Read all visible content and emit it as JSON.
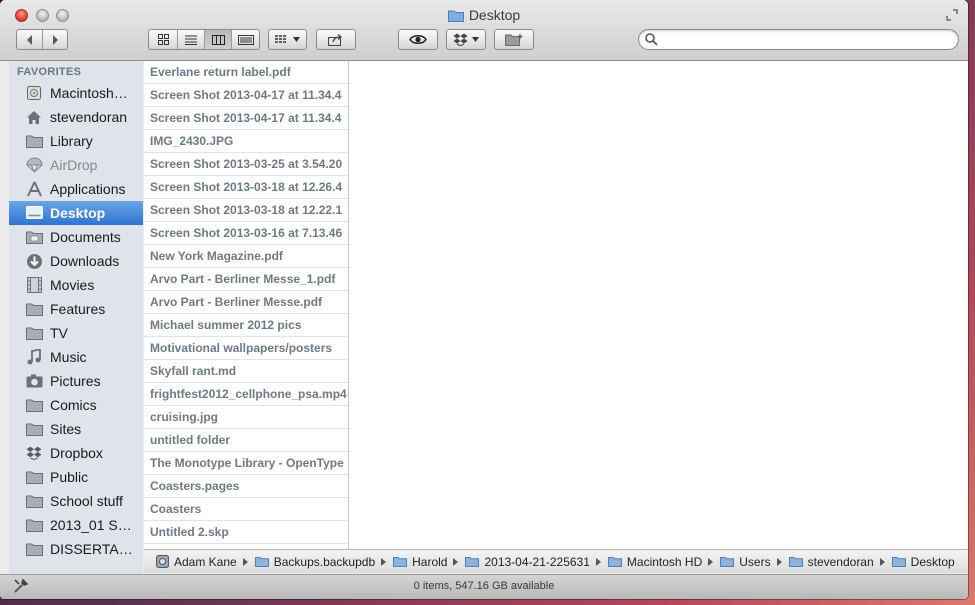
{
  "window": {
    "title": "Desktop"
  },
  "toolbar": {
    "back_icon": "chevron-left-icon",
    "forward_icon": "chevron-right-icon",
    "view_modes": [
      "icon-view",
      "list-view",
      "column-view",
      "cover-flow-view"
    ],
    "active_view": "column-view",
    "arrange_icon": "arrange-grid-icon",
    "share_icon": "share-icon",
    "quicklook_icon": "eye-icon",
    "dropbox_icon": "dropbox-icon",
    "new_folder_icon": "new-folder-icon"
  },
  "search": {
    "value": "",
    "placeholder": ""
  },
  "sidebar": {
    "heading": "FAVORITES",
    "items": [
      {
        "label": "Macintosh…",
        "icon": "hard-drive-icon"
      },
      {
        "label": "stevendoran",
        "icon": "home-icon"
      },
      {
        "label": "Library",
        "icon": "folder-icon"
      },
      {
        "label": "AirDrop",
        "icon": "airdrop-icon"
      },
      {
        "label": "Applications",
        "icon": "applications-icon"
      },
      {
        "label": "Desktop",
        "icon": "desktop-icon"
      },
      {
        "label": "Documents",
        "icon": "documents-icon"
      },
      {
        "label": "Downloads",
        "icon": "downloads-icon"
      },
      {
        "label": "Movies",
        "icon": "movies-icon"
      },
      {
        "label": "Features",
        "icon": "folder-icon"
      },
      {
        "label": "TV",
        "icon": "folder-icon"
      },
      {
        "label": "Music",
        "icon": "music-icon"
      },
      {
        "label": "Pictures",
        "icon": "pictures-icon"
      },
      {
        "label": "Comics",
        "icon": "folder-icon"
      },
      {
        "label": "Sites",
        "icon": "sites-icon"
      },
      {
        "label": "Dropbox",
        "icon": "dropbox-icon"
      },
      {
        "label": "Public",
        "icon": "folder-icon"
      },
      {
        "label": "School stuff",
        "icon": "folder-icon"
      },
      {
        "label": "2013_01 S…",
        "icon": "folder-icon"
      },
      {
        "label": "DISSERTA…",
        "icon": "folder-icon"
      }
    ],
    "selected": "Desktop"
  },
  "files": [
    "Everlane return label.pdf",
    "Screen Shot 2013-04-17 at 11.34.4",
    "Screen Shot 2013-04-17 at 11.34.4",
    "IMG_2430.JPG",
    "Screen Shot 2013-03-25 at 3.54.20",
    "Screen Shot 2013-03-18 at 12.26.4",
    "Screen Shot 2013-03-18 at 12.22.1",
    "Screen Shot 2013-03-16 at 7.13.46",
    "New York Magazine.pdf",
    "Arvo Part - Berliner Messe_1.pdf",
    "Arvo Part - Berliner Messe.pdf",
    "Michael summer 2012 pics",
    "Motivational wallpapers/posters",
    "Skyfall rant.md",
    "frightfest2012_cellphone_psa.mp4",
    "cruising.jpg",
    "untitled folder",
    "The Monotype Library - OpenType",
    "Coasters.pages",
    "Coasters",
    "Untitled 2.skp"
  ],
  "pathbar": [
    {
      "label": "Adam Kane",
      "icon": "disk-icon"
    },
    {
      "label": "Backups.backupdb",
      "icon": "folder-icon"
    },
    {
      "label": "Harold",
      "icon": "folder-icon"
    },
    {
      "label": "2013-04-21-225631",
      "icon": "folder-icon"
    },
    {
      "label": "Macintosh HD",
      "icon": "folder-icon"
    },
    {
      "label": "Users",
      "icon": "folder-icon"
    },
    {
      "label": "stevendoran",
      "icon": "folder-icon"
    },
    {
      "label": "Desktop",
      "icon": "folder-icon"
    }
  ],
  "status": {
    "text": "0 items, 547.16 GB available"
  },
  "colors": {
    "selection": "#2d74d0",
    "sidebar_bg": "#dee4ea",
    "file_text": "#6d7a86"
  }
}
